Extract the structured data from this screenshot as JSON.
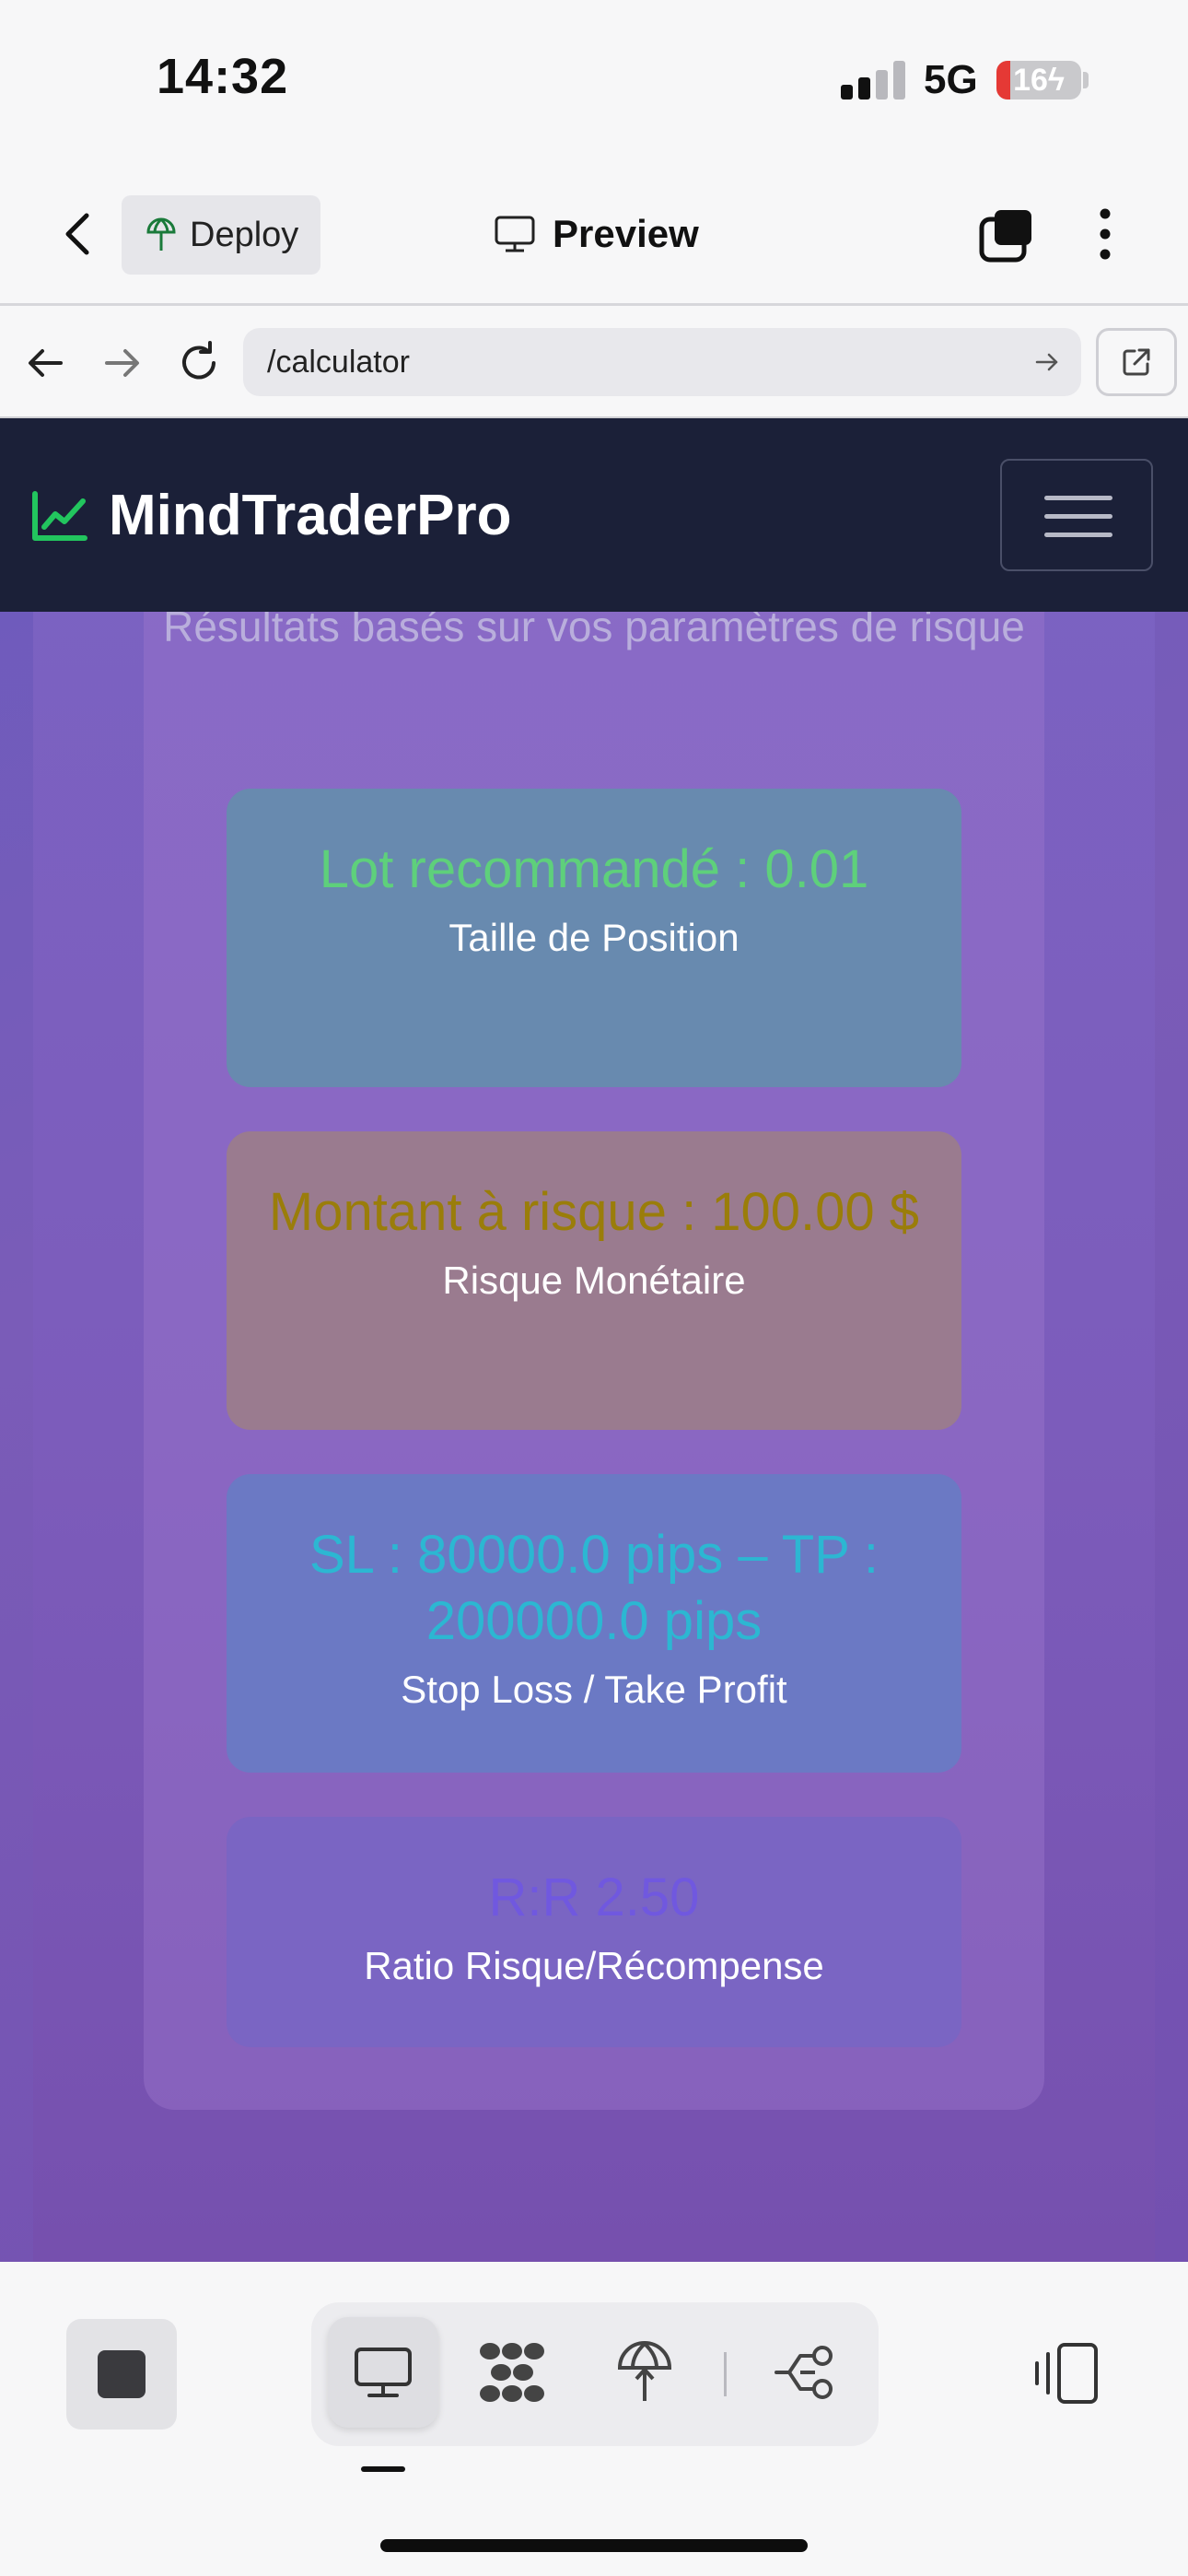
{
  "status_bar": {
    "time": "14:32",
    "network": "5G",
    "battery": "16",
    "battery_percent": 16
  },
  "top_bar": {
    "deploy_label": "Deploy",
    "preview_label": "Preview"
  },
  "url_bar": {
    "path": "/calculator"
  },
  "app": {
    "brand": "MindTraderPro",
    "brand_color": "#22c55e",
    "navbar_color": "#1b2038",
    "results_subtitle": "Résultats basés sur vos paramètres de risque",
    "cards": [
      {
        "value": "Lot recommandé : 0.01",
        "label": "Taille de Position",
        "color": "#5ed07b"
      },
      {
        "value": "Montant à risque : 100.00 $",
        "label": "Risque Monétaire",
        "color": "#9a7d0a"
      },
      {
        "value": "SL : 80000.0 pips – TP : 200000.0 pips",
        "label": "Stop Loss / Take Profit",
        "color": "#2cb7d2"
      },
      {
        "value": "R:R 2.50",
        "label": "Ratio Risque/Récompense",
        "color": "#6e56e6"
      }
    ]
  },
  "bottom_toolbar": {
    "tools": [
      "preview-icon",
      "apps-icon",
      "deploy-icon",
      "workflow-icon"
    ],
    "active_tool": "preview-icon"
  }
}
